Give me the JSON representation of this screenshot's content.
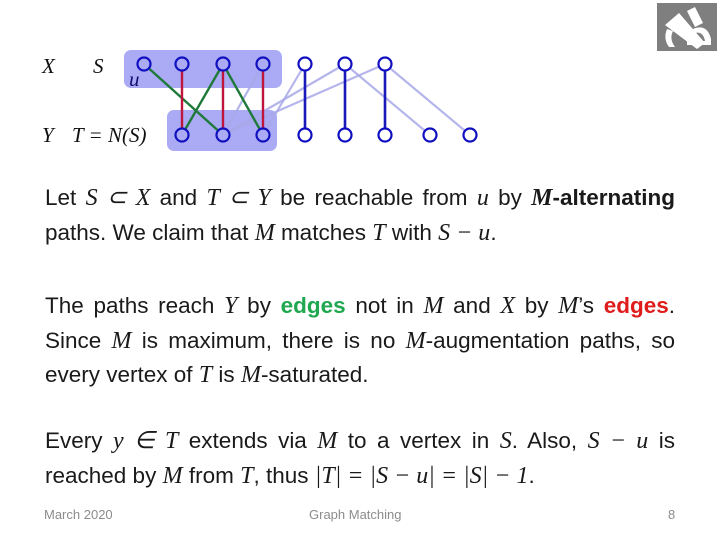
{
  "diagram": {
    "labels": {
      "x_set": "X",
      "s_set": "S",
      "u_vertex": "u",
      "y_set": "Y",
      "t_eq": "T = N(S)"
    },
    "colors": {
      "vertex_stroke": "#1010c0",
      "highlight_fill": "#aaaaf5",
      "matched_edge_in_S": "#c0143c",
      "alternating_edge": "#1f7a3a",
      "matched_edge_other": "#1a1ab8",
      "other_edge": "#a8a8e8"
    },
    "top_vertices": [
      "x1",
      "x2",
      "x3",
      "x4",
      "x5",
      "x6",
      "x7"
    ],
    "bottom_vertices": [
      "y1",
      "y2",
      "y3",
      "y4",
      "y5",
      "y6",
      "y7",
      "y8"
    ],
    "S": [
      "x1",
      "x2",
      "x3",
      "x4"
    ],
    "T": [
      "y1",
      "y2",
      "y3"
    ],
    "edges": [
      {
        "from": "x2",
        "to": "y1",
        "type": "matched_in_S"
      },
      {
        "from": "x3",
        "to": "y2",
        "type": "matched_in_S"
      },
      {
        "from": "x4",
        "to": "y3",
        "type": "matched_in_S"
      },
      {
        "from": "x1",
        "to": "y2",
        "type": "alternating"
      },
      {
        "from": "x3",
        "to": "y1",
        "type": "alternating"
      },
      {
        "from": "x3",
        "to": "y3",
        "type": "alternating"
      },
      {
        "from": "x5",
        "to": "y4",
        "type": "matched_other"
      },
      {
        "from": "x6",
        "to": "y5",
        "type": "matched_other"
      },
      {
        "from": "x7",
        "to": "y6",
        "type": "matched_other"
      },
      {
        "from": "x4",
        "to": "y2",
        "type": "other"
      },
      {
        "from": "x6",
        "to": "y2",
        "type": "other"
      },
      {
        "from": "x7",
        "to": "y2",
        "type": "other"
      },
      {
        "from": "x5",
        "to": "y3",
        "type": "other"
      },
      {
        "from": "x6",
        "to": "y7",
        "type": "other"
      },
      {
        "from": "x7",
        "to": "y8",
        "type": "other"
      }
    ]
  },
  "logo": {
    "icon": "university-logo-icon"
  },
  "paragraphs": {
    "p1": {
      "t1": "Let ",
      "m1": "S ⊂ X",
      "t2": " and ",
      "m2": "T ⊂ Y",
      "t3": " be reachable from ",
      "m3": "u",
      "t4": " by ",
      "mb1": "M",
      "b1": "-alternating",
      "t5": " paths. We claim that ",
      "m4": "M",
      "t6": " matches ",
      "m5": "T",
      "t7": " with ",
      "m6": "S − u",
      "t8": "."
    },
    "p2": {
      "t1": "The paths reach ",
      "m1": "Y",
      "t2": " by ",
      "g1": "edges",
      "t3": " not in ",
      "m2": "M",
      "t4": " and ",
      "m3": "X",
      "t5": " by ",
      "m4": "M",
      "t6": "’s ",
      "r1": "edges",
      "t7": ". Since ",
      "m5": "M",
      "t8": " is maximum, there is no ",
      "m6": "M",
      "t9": "-augmentation paths, so every vertex of ",
      "m7": "T",
      "t10": " is ",
      "m8": "M",
      "t11": "-saturated."
    },
    "p3": {
      "t1": "Every ",
      "m1": "y ∈ T",
      "t2": " extends via ",
      "m2": "M",
      "t3": " to a vertex in ",
      "m3": "S",
      "t4": ". Also, ",
      "m4": "S − u",
      "t5": " is reached by ",
      "m5": "M",
      "t6": " from ",
      "m6": "T",
      "t7": ", thus ",
      "m7": "|T| = |S − u| = |S| − 1",
      "t8": "."
    }
  },
  "footer": {
    "date": "March 2020",
    "title": "Graph Matching",
    "page": "8"
  }
}
